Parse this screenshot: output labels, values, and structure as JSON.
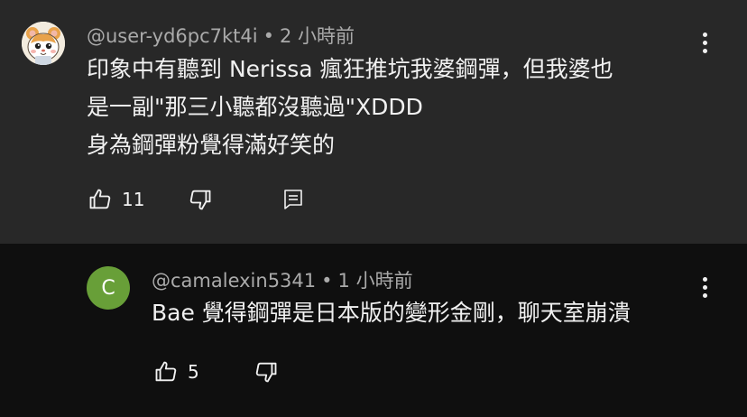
{
  "comments": {
    "top": {
      "username": "@user-yd6pc7kt4i",
      "time": "2 小時前",
      "lines": [
        "印象中有聽到 Nerissa 瘋狂推坑我婆鋼彈，但我婆也",
        "是一副\"那三小聽都沒聽過\"XDDD",
        "身為鋼彈粉覺得滿好笑的"
      ],
      "like_count": "11"
    },
    "reply": {
      "avatar_letter": "C",
      "username": "@camalexin5341",
      "time": "1 小時前",
      "lines": [
        "Bae 覺得鋼彈是日本版的變形金剛，聊天室崩潰"
      ],
      "like_count": "5"
    }
  },
  "colors": {
    "top_background": "#282828",
    "reply_background": "#0f0f0f",
    "meta_text": "#aaaaaa",
    "body_text": "#f1f1f1",
    "reply_avatar": "#689f38"
  },
  "icons": {
    "top_avatar": "hamster-avatar",
    "more": "more-vert-icon",
    "like": "thumb-up-icon",
    "dislike": "thumb-down-icon",
    "reply": "comment-icon"
  }
}
